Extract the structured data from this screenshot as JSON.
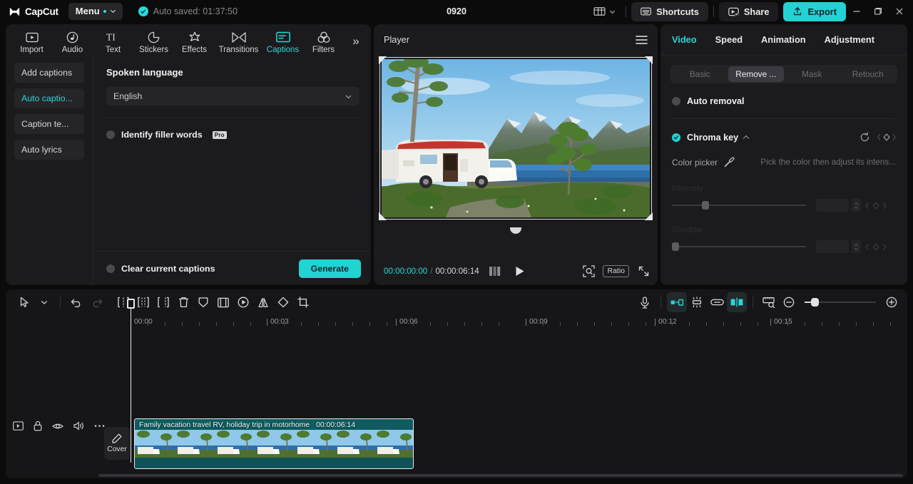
{
  "titlebar": {
    "brand": "CapCut",
    "menu_label": "Menu",
    "autosave_text": "Auto saved: 01:37:50",
    "project_title": "0920",
    "layout_icon": "layout-icon",
    "shortcuts_label": "Shortcuts",
    "share_label": "Share",
    "export_label": "Export",
    "minimize": "—",
    "maximize": "❐",
    "close": "✕"
  },
  "toolbar_tabs": [
    {
      "label": "Import",
      "icon": "import-icon"
    },
    {
      "label": "Audio",
      "icon": "audio-note-icon"
    },
    {
      "label": "Text",
      "icon": "text-ti-icon"
    },
    {
      "label": "Stickers",
      "icon": "sticker-icon"
    },
    {
      "label": "Effects",
      "icon": "effects-sparkle-icon"
    },
    {
      "label": "Transitions",
      "icon": "transitions-icon"
    },
    {
      "label": "Captions",
      "icon": "captions-icon"
    },
    {
      "label": "Filters",
      "icon": "filters-circles-icon"
    }
  ],
  "toolbar_active": "Captions",
  "toolbar_more": "»",
  "left_nav": [
    {
      "label": "Add captions",
      "active": false
    },
    {
      "label": "Auto captio...",
      "active": true
    },
    {
      "label": "Caption te...",
      "active": false
    },
    {
      "label": "Auto lyrics",
      "active": false
    }
  ],
  "captions_panel": {
    "section_title": "Spoken language",
    "language_value": "English",
    "filler_words_label": "Identify filler words",
    "pro_badge": "Pro",
    "clear_captions_label": "Clear current captions",
    "generate_label": "Generate"
  },
  "player": {
    "title": "Player",
    "menu_icon": "hamburger-icon",
    "current_time": "00:00:00:00",
    "time_separator": "/",
    "total_time": "00:00:06:14",
    "quality_icon": "quality-bars-icon",
    "play_icon": "play-icon",
    "magnifier_icon": "zoom-fit-icon",
    "ratio_label": "Ratio",
    "fullscreen_icon": "fullscreen-icon"
  },
  "right_panel": {
    "tabs": [
      "Video",
      "Speed",
      "Animation",
      "Adjustment"
    ],
    "active_tab": "Video",
    "segments": [
      "Basic",
      "Remove ...",
      "Mask",
      "Retouch"
    ],
    "active_segment": "Remove ...",
    "auto_removal_label": "Auto removal",
    "auto_removal_on": false,
    "chroma_key_label": "Chroma key",
    "chroma_key_on": true,
    "reset_icon": "reset-icon",
    "keyframe_icon": "keyframe-diamond-icon",
    "color_picker_label": "Color picker",
    "eyedropper_icon": "eyedropper-icon",
    "color_picker_hint": "Pick the color then adjust its intens...",
    "intensity_label": "Intensity",
    "intensity_value": "",
    "shadow_label": "Shadow",
    "shadow_value": ""
  },
  "timeline": {
    "tools_left": [
      {
        "icon": "select-arrow-icon",
        "name": "select-tool",
        "state": "normal"
      },
      {
        "icon": "chevron-down-icon",
        "name": "tool-dropdown",
        "state": "normal"
      },
      {
        "icon": "undo-icon",
        "name": "undo",
        "state": "normal"
      },
      {
        "icon": "redo-icon",
        "name": "redo",
        "state": "disabled"
      },
      {
        "icon": "split-left-icon",
        "name": "split-left",
        "state": "normal"
      },
      {
        "icon": "split-icon",
        "name": "split",
        "state": "normal"
      },
      {
        "icon": "split-right-icon",
        "name": "split-right",
        "state": "normal"
      },
      {
        "icon": "delete-icon",
        "name": "delete",
        "state": "normal"
      },
      {
        "icon": "freeze-icon",
        "name": "freeze",
        "state": "normal"
      },
      {
        "icon": "crop-frame-icon",
        "name": "crop-frame",
        "state": "normal"
      },
      {
        "icon": "speed-icon",
        "name": "speed",
        "state": "normal"
      },
      {
        "icon": "mirror-icon",
        "name": "mirror",
        "state": "normal"
      },
      {
        "icon": "rotate-icon",
        "name": "rotate",
        "state": "normal"
      },
      {
        "icon": "crop-icon",
        "name": "crop",
        "state": "normal"
      }
    ],
    "tools_right": [
      {
        "icon": "microphone-icon",
        "name": "record-voiceover",
        "state": "normal"
      },
      {
        "icon": "auto-fit-icon",
        "name": "auto-fit",
        "state": "active"
      },
      {
        "icon": "magnet-icon",
        "name": "magnet-snap",
        "state": "normal"
      },
      {
        "icon": "link-icon",
        "name": "link-av",
        "state": "normal"
      },
      {
        "icon": "adsorb-icon",
        "name": "adsorb",
        "state": "active"
      },
      {
        "icon": "preview-ruler-icon",
        "name": "preview-scale",
        "state": "normal"
      },
      {
        "icon": "zoom-out-icon",
        "name": "zoom-out",
        "state": "normal"
      },
      {
        "icon": "zoom-in-icon",
        "name": "zoom-in",
        "state": "normal"
      }
    ],
    "ruler_labels": [
      "00:00",
      "00:03",
      "00:06",
      "00:09",
      "00:12",
      "00:15"
    ],
    "track_icons": [
      "track-thumbnail-icon",
      "lock-icon",
      "eye-icon",
      "volume-icon",
      "more-icon"
    ],
    "cover_label": "Cover",
    "cover_icon": "pencil-icon",
    "clip": {
      "name": "Family vacation travel RV, holiday trip in motorhome",
      "duration": "00:00:06:14"
    }
  },
  "colors": {
    "accent": "#22d3d3",
    "panel_bg": "#1b1b1d",
    "app_bg": "#0b0b0b",
    "timeline_bg": "#161618",
    "clip_teal": "#0e5c60",
    "text_primary": "#efeff2",
    "text_muted": "#8a8a8f"
  }
}
